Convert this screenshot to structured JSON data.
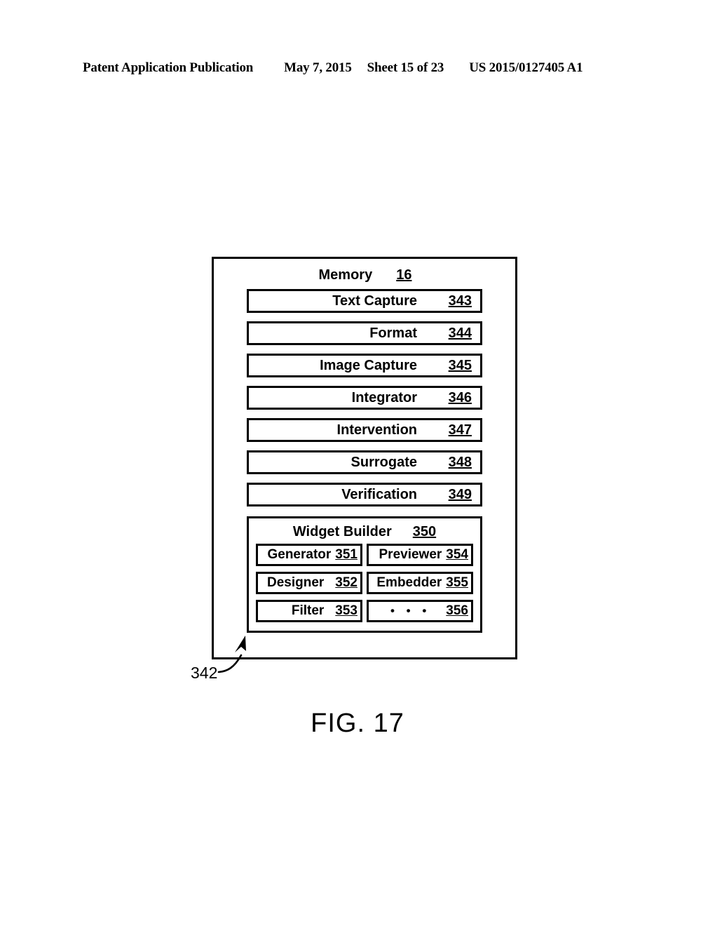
{
  "page_header": {
    "title": "Patent Application Publication",
    "date": "May 7, 2015",
    "sheet": "Sheet 15 of 23",
    "publication_number": "US 2015/0127405 A1"
  },
  "figure": {
    "caption": "FIG. 17",
    "reference_label": "342",
    "memory_block": {
      "title": "Memory",
      "ref": "16",
      "modules": [
        {
          "label": "Text Capture",
          "ref": "343"
        },
        {
          "label": "Format",
          "ref": "344"
        },
        {
          "label": "Image Capture",
          "ref": "345"
        },
        {
          "label": "Integrator",
          "ref": "346"
        },
        {
          "label": "Intervention",
          "ref": "347"
        },
        {
          "label": "Surrogate",
          "ref": "348"
        },
        {
          "label": "Verification",
          "ref": "349"
        }
      ],
      "widget_builder": {
        "title": "Widget Builder",
        "ref": "350",
        "components": [
          {
            "label": "Generator",
            "ref": "351"
          },
          {
            "label": "Previewer",
            "ref": "354"
          },
          {
            "label": "Designer",
            "ref": "352"
          },
          {
            "label": "Embedder",
            "ref": "355"
          },
          {
            "label": "Filter",
            "ref": "353"
          },
          {
            "label": "• • •",
            "ref": "356"
          }
        ]
      }
    }
  }
}
